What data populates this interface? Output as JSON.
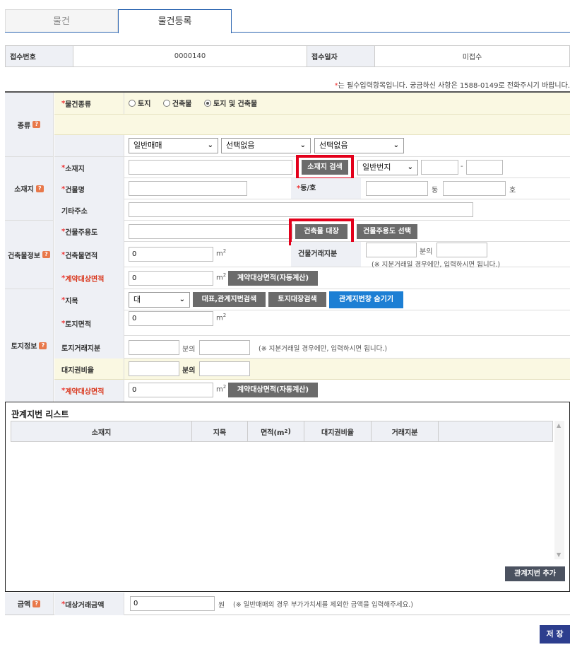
{
  "tabs": [
    {
      "label": "물건"
    },
    {
      "label": "물건등록"
    }
  ],
  "info": {
    "receipt_no_label": "접수번호",
    "receipt_no": "0000140",
    "receipt_date_label": "접수일자",
    "receipt_date": "미접수"
  },
  "notice": {
    "star": "*",
    "text": "는 필수입력항목입니다. 궁금하신 사항은 1588-0149로 전화주시기 바랍니다."
  },
  "qicon": "?",
  "required_mark": "*",
  "kind": {
    "section": "종류",
    "type_label": "물건종류",
    "radios": [
      "토지",
      "건축물",
      "토지 및 건축물"
    ],
    "selected_radio": "토지 및 건축물",
    "selects": [
      "일반매매",
      "선택없음",
      "선택없음"
    ]
  },
  "location": {
    "section": "소재지",
    "address_label": "소재지",
    "address_search_btn": "소재지 검색",
    "lot_type": "일반번지",
    "dash": "-",
    "building_name_label": "건물명",
    "dong_ho_label": "동/호",
    "dong_unit": "동",
    "ho_unit": "호",
    "other_address_label": "기타주소"
  },
  "building": {
    "section": "건축물정보",
    "use_label": "건물주용도",
    "ledger_btn": "건축물 대장",
    "use_select_btn": "건물주용도 선택",
    "area_label": "건축물면적",
    "area_value": "0",
    "m2": "m",
    "sq": "2",
    "share_label": "건물거래지분",
    "share_of": "분의",
    "share_note": "(※ 지분거래일 경우에만, 입력하시면 됩니다.)",
    "contract_area_label": "계약대상면적",
    "contract_area_value": "0",
    "auto_calc_btn": "계약대상면적(자동계산)"
  },
  "land": {
    "section": "토지정보",
    "jimok_label": "지목",
    "jimok_value": "대",
    "rep_search_btn": "대표,관계지번검색",
    "land_ledger_btn": "토지대장검색",
    "toggle_btn": "관계지번창 숨기기",
    "area_label": "토지면적",
    "area_value": "0",
    "share_label": "토지거래지분",
    "share_of": "분의",
    "share_note": "(※ 지분거래일 경우에만, 입력하시면 됩니다.)",
    "ratio_label": "대지권비율",
    "ratio_of": "분의",
    "contract_area_label": "계약대상면적",
    "contract_area_value": "0",
    "auto_calc_btn": "계약대상면적(자동계산)"
  },
  "related_list": {
    "title": "관계지번 리스트",
    "columns": [
      "소재지",
      "지목",
      "면적(m",
      "대지권비율",
      "거래지분"
    ],
    "add_btn": "관계지번 추가"
  },
  "price": {
    "section": "금액",
    "label": "대상거래금액",
    "value": "0",
    "unit": "원",
    "note": "(※ 일반매매의 경우 부가가치세를 제외한 금액을 입력해주세요.)"
  },
  "save_btn": "저 장",
  "colors": {
    "accent_blue": "#2a64b0",
    "required_red": "#e33",
    "highlight_box": "#e3001b",
    "save_button": "#2d3e8e"
  }
}
